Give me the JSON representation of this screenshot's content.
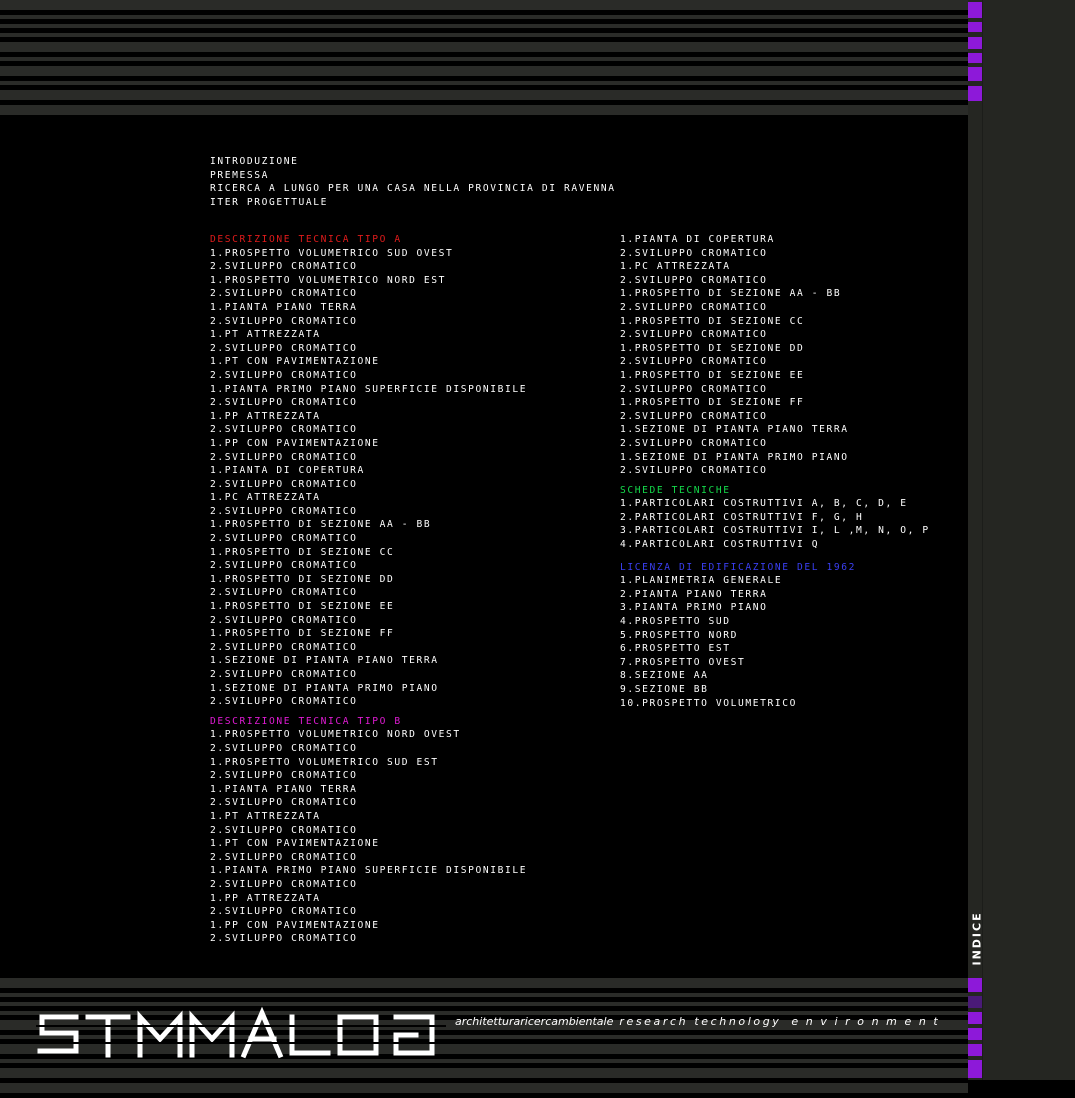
{
  "intro": [
    "INTRODUZIONE",
    "PREMESSA",
    "RICERCA A LUNGO PER UNA CASA NELLA PROVINCIA DI RAVENNA",
    "ITER PROGETTUALE"
  ],
  "section_a": {
    "title": "DESCRIZIONE TECNICA TIPO A",
    "items": [
      "1.PROSPETTO VOLUMETRICO SUD OVEST",
      "2.SVILUPPO CROMATICO",
      "1.PROSPETTO VOLUMETRICO NORD EST",
      "2.SVILUPPO CROMATICO",
      "1.PIANTA PIANO TERRA",
      "2.SVILUPPO CROMATICO",
      "1.PT ATTREZZATA",
      "2.SVILUPPO CROMATICO",
      "1.PT CON PAVIMENTAZIONE",
      "2.SVILUPPO CROMATICO",
      "1.PIANTA PRIMO PIANO SUPERFICIE DISPONIBILE",
      "2.SVILUPPO CROMATICO",
      "1.PP ATTREZZATA",
      "2.SVILUPPO CROMATICO",
      "1.PP CON PAVIMENTAZIONE",
      "2.SVILUPPO CROMATICO",
      "1.PIANTA DI COPERTURA",
      "2.SVILUPPO CROMATICO",
      "1.PC ATTREZZATA",
      "2.SVILUPPO CROMATICO",
      "1.PROSPETTO DI SEZIONE AA - BB",
      "2.SVILUPPO CROMATICO",
      "1.PROSPETTO DI SEZIONE CC",
      "2.SVILUPPO CROMATICO",
      "1.PROSPETTO DI SEZIONE DD",
      "2.SVILUPPO CROMATICO",
      "1.PROSPETTO DI SEZIONE EE",
      "2.SVILUPPO CROMATICO",
      "1.PROSPETTO DI SEZIONE FF",
      "2.SVILUPPO CROMATICO",
      "1.SEZIONE DI PIANTA PIANO TERRA",
      "2.SVILUPPO CROMATICO",
      "1.SEZIONE DI PIANTA PRIMO PIANO",
      "2.SVILUPPO CROMATICO"
    ]
  },
  "section_b": {
    "title": "DESCRIZIONE TECNICA TIPO B",
    "items": [
      "1.PROSPETTO VOLUMETRICO NORD OVEST",
      "2.SVILUPPO CROMATICO",
      "1.PROSPETTO VOLUMETRICO SUD EST",
      "2.SVILUPPO CROMATICO",
      "1.PIANTA PIANO TERRA",
      "2.SVILUPPO CROMATICO",
      "1.PT ATTREZZATA",
      "2.SVILUPPO CROMATICO",
      "1.PT CON PAVIMENTAZIONE",
      "2.SVILUPPO CROMATICO",
      "1.PIANTA PRIMO PIANO SUPERFICIE DISPONIBILE",
      "2.SVILUPPO CROMATICO",
      "1.PP ATTREZZATA",
      "2.SVILUPPO CROMATICO",
      "1.PP CON PAVIMENTAZIONE",
      "2.SVILUPPO CROMATICO"
    ],
    "continued": [
      "1.PIANTA DI COPERTURA",
      "2.SVILUPPO CROMATICO",
      "1.PC ATTREZZATA",
      "2.SVILUPPO CROMATICO",
      "1.PROSPETTO DI SEZIONE AA - BB",
      "2.SVILUPPO CROMATICO",
      "1.PROSPETTO DI SEZIONE CC",
      "2.SVILUPPO CROMATICO",
      "1.PROSPETTO DI SEZIONE DD",
      "2.SVILUPPO CROMATICO",
      "1.PROSPETTO DI SEZIONE EE",
      "2.SVILUPPO CROMATICO",
      "1.PROSPETTO DI SEZIONE FF",
      "2.SVILUPPO CROMATICO",
      "1.SEZIONE DI PIANTA PIANO TERRA",
      "2.SVILUPPO CROMATICO",
      "1.SEZIONE DI PIANTA PRIMO PIANO",
      "2.SVILUPPO CROMATICO"
    ]
  },
  "schede": {
    "title": "SCHEDE TECNICHE",
    "items": [
      "1.PARTICOLARI COSTRUTTIVI A, B, C, D, E",
      "2.PARTICOLARI COSTRUTTIVI F, G, H",
      "3.PARTICOLARI COSTRUTTIVI I, L ,M, N, O, P",
      "4.PARTICOLARI COSTRUTTIVI Q"
    ]
  },
  "licenza": {
    "title": "LICENZA DI EDIFICAZIONE DEL 1962",
    "items": [
      "1.PLANIMETRIA GENERALE",
      "2.PIANTA PIANO TERRA",
      "3.PIANTA PRIMO PIANO",
      "4.PROSPETTO SUD",
      "5.PROSPETTO NORD",
      "6.PROSPETTO EST",
      "7.PROSPETTO OVEST",
      "8.SEZIONE AA",
      "9.SEZIONE BB",
      "10.PROSPETTO VOLUMETRICO"
    ]
  },
  "side_label": "INDICE",
  "tagline": {
    "a": "architetturaricercambientale",
    "b": "research technology",
    "c": "environment"
  },
  "colors": {
    "background": "#000000",
    "stripe": "#2a2b28",
    "panel": "#252622",
    "accent_purple": "#8d19d9",
    "red": "#e01b1b",
    "magenta": "#e01bd4",
    "green": "#14d94a",
    "blue": "#3a3ff2"
  }
}
